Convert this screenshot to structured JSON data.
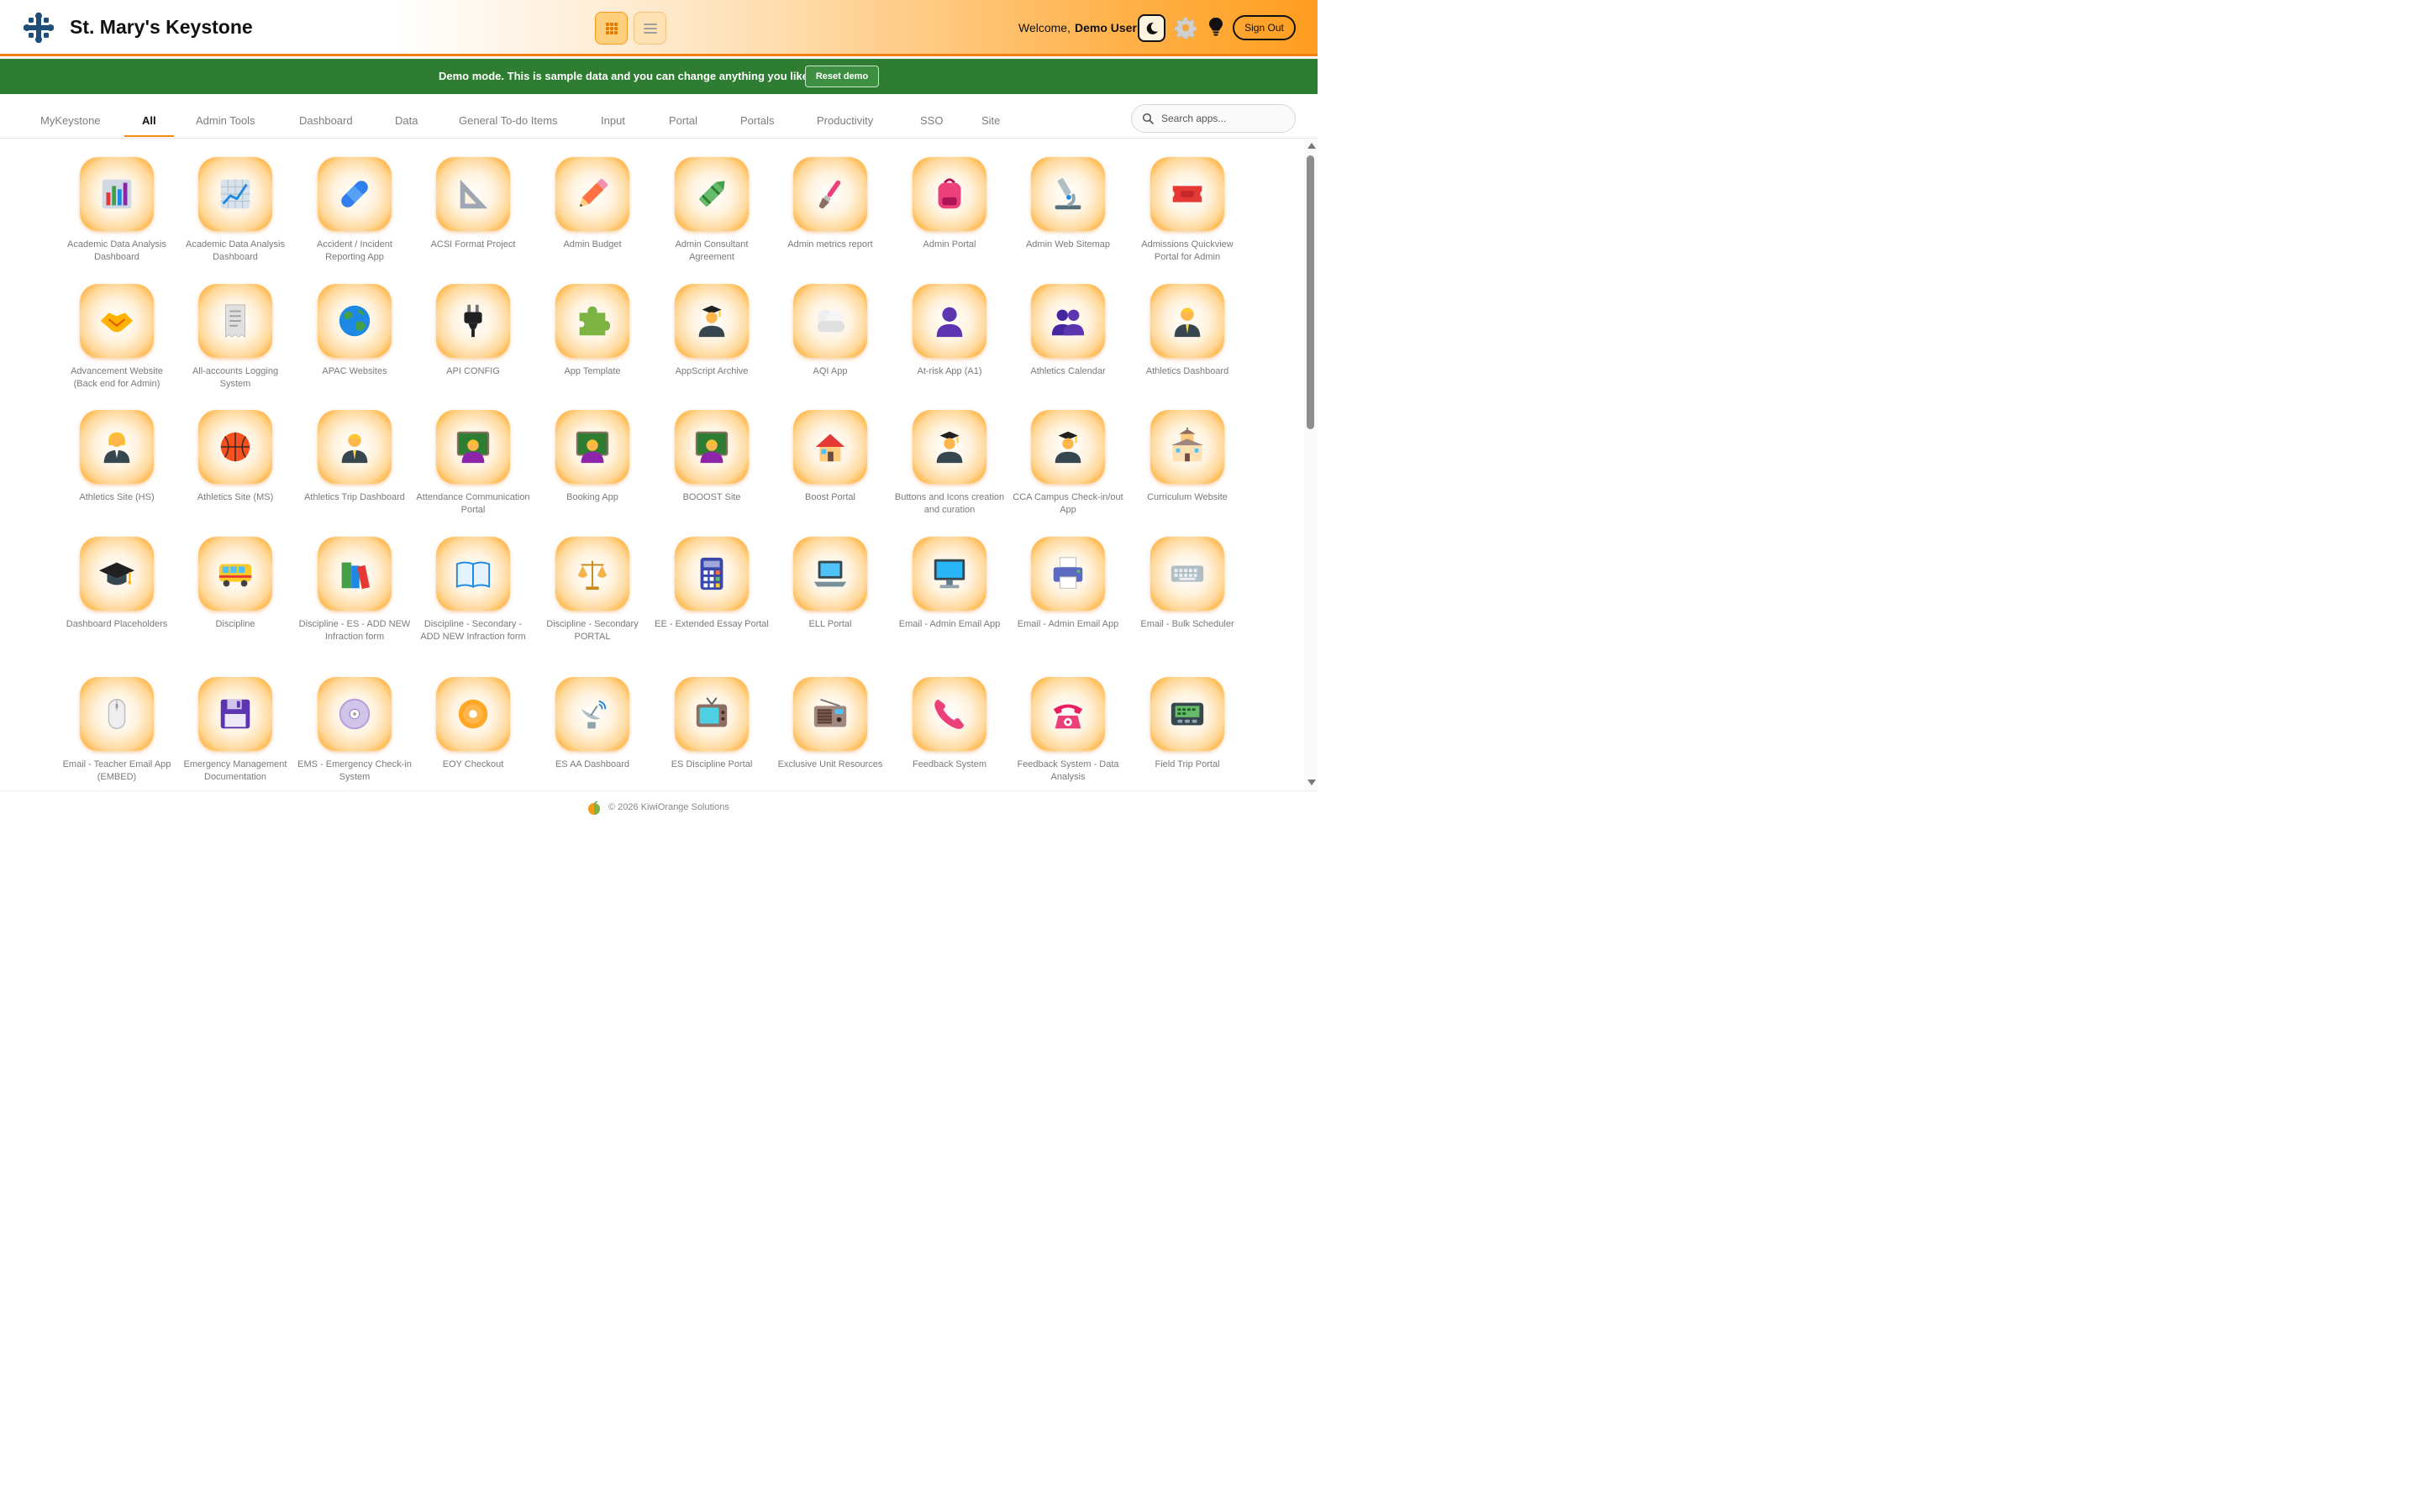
{
  "header": {
    "brand": "St. Mary's Keystone",
    "welcome": "Welcome,",
    "username": "Demo User",
    "signout_label": "Sign Out",
    "icons": [
      "keystone-logo-icon",
      "grid-view-icon",
      "list-view-icon",
      "moon-icon",
      "gear-icon",
      "lightbulb-icon"
    ]
  },
  "banner": {
    "text": "Demo mode. This is sample data and you can change anything you like.",
    "reset_label": "Reset demo",
    "color": "#2e7d32"
  },
  "tabs": {
    "items": [
      "MyKeystone",
      "All",
      "Admin Tools",
      "Dashboard",
      "Data",
      "General To-do Items",
      "Input",
      "Portal",
      "Portals",
      "Productivity",
      "SSO",
      "Site"
    ],
    "active": "All",
    "accent": "#f08a18"
  },
  "search": {
    "placeholder": "Search apps..."
  },
  "apps": [
    {
      "label": "Academic Data Analysis Dashboard",
      "icon": "bar-chart-icon"
    },
    {
      "label": "Academic Data Analysis Dashboard",
      "icon": "line-chart-icon"
    },
    {
      "label": "Accident / Incident Reporting App",
      "icon": "bandage-icon"
    },
    {
      "label": "ACSI Format Project",
      "icon": "set-square-icon"
    },
    {
      "label": "Admin Budget",
      "icon": "pencil-icon"
    },
    {
      "label": "Admin Consultant Agreement",
      "icon": "crayon-icon"
    },
    {
      "label": "Admin metrics report",
      "icon": "paintbrush-icon"
    },
    {
      "label": "Admin Portal",
      "icon": "backpack-icon"
    },
    {
      "label": "Admin Web Sitemap",
      "icon": "microscope-icon"
    },
    {
      "label": "Admissions Quickview Portal for Admin",
      "icon": "ticket-icon"
    },
    {
      "label": "Advancement Website (Back end for Admin)",
      "icon": "handshake-icon"
    },
    {
      "label": "All-accounts Logging System",
      "icon": "receipt-icon"
    },
    {
      "label": "APAC Websites",
      "icon": "globe-icon"
    },
    {
      "label": "API CONFIG",
      "icon": "plug-icon"
    },
    {
      "label": "App Template",
      "icon": "puzzle-icon"
    },
    {
      "label": "AppScript Archive",
      "icon": "graduate-icon"
    },
    {
      "label": "AQI App",
      "icon": "fog-icon"
    },
    {
      "label": "At-risk App (A1)",
      "icon": "person-silhouette-icon"
    },
    {
      "label": "Athletics Calendar",
      "icon": "people-silhouette-icon"
    },
    {
      "label": "Athletics Dashboard",
      "icon": "man-office-worker-icon"
    },
    {
      "label": "Athletics Site (HS)",
      "icon": "woman-office-worker-icon"
    },
    {
      "label": "Athletics Site (MS)",
      "icon": "basketball-icon"
    },
    {
      "label": "Athletics Trip Dashboard",
      "icon": "man-office-worker-icon"
    },
    {
      "label": "Attendance Communication Portal",
      "icon": "teacher-icon"
    },
    {
      "label": "Booking App",
      "icon": "teacher-icon"
    },
    {
      "label": "BOOOST Site",
      "icon": "teacher-icon"
    },
    {
      "label": "Boost Portal",
      "icon": "house-icon"
    },
    {
      "label": "Buttons and Icons creation and curation",
      "icon": "graduate-icon"
    },
    {
      "label": "CCA Campus Check-in/out App",
      "icon": "graduate-icon"
    },
    {
      "label": "Curriculum Website",
      "icon": "school-icon"
    },
    {
      "label": "Dashboard Placeholders",
      "icon": "graduation-cap-icon"
    },
    {
      "label": "Discipline",
      "icon": "bus-icon"
    },
    {
      "label": "Discipline - ES - ADD NEW Infraction form",
      "icon": "books-icon"
    },
    {
      "label": "Discipline - Secondary - ADD NEW Infraction form",
      "icon": "open-book-icon"
    },
    {
      "label": "Discipline - Secondary PORTAL",
      "icon": "scales-icon"
    },
    {
      "label": "EE - Extended Essay Portal",
      "icon": "calculator-icon"
    },
    {
      "label": "ELL Portal",
      "icon": "laptop-icon"
    },
    {
      "label": "Email - Admin Email App",
      "icon": "desktop-computer-icon"
    },
    {
      "label": "Email - Admin Email App",
      "icon": "printer-icon"
    },
    {
      "label": "Email - Bulk Scheduler",
      "icon": "keyboard-icon"
    },
    {
      "label": "Email - Teacher Email App (EMBED)",
      "icon": "mouse-icon"
    },
    {
      "label": "Emergency Management Documentation",
      "icon": "floppy-disk-icon"
    },
    {
      "label": "EMS - Emergency Check-in System",
      "icon": "cd-icon"
    },
    {
      "label": "EOY Checkout",
      "icon": "dvd-icon"
    },
    {
      "label": "ES AA Dashboard",
      "icon": "satellite-dish-icon"
    },
    {
      "label": "ES Discipline Portal",
      "icon": "television-icon"
    },
    {
      "label": "Exclusive Unit Resources",
      "icon": "radio-icon"
    },
    {
      "label": "Feedback System",
      "icon": "telephone-receiver-icon"
    },
    {
      "label": "Feedback System - Data Analysis",
      "icon": "telephone-icon"
    },
    {
      "label": "Field Trip Portal",
      "icon": "pager-icon"
    }
  ],
  "footer": {
    "text": "© 2026 KiwiOrange Solutions"
  }
}
